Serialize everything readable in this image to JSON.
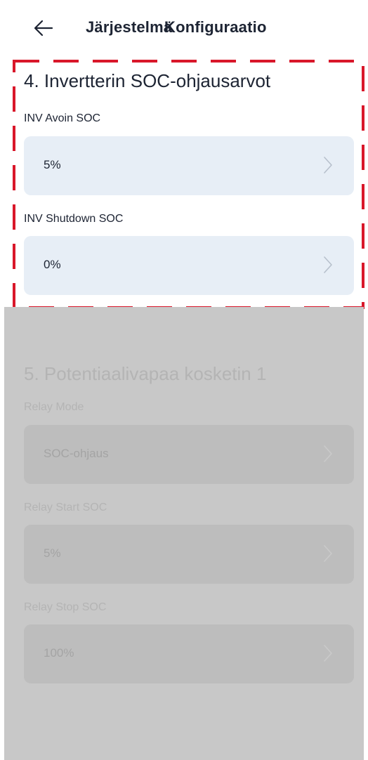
{
  "header": {
    "back_icon": "arrow-left-icon",
    "title_overlap_a": "Järjestelmä",
    "title_overlap_b": "Konfiguraatio"
  },
  "section4": {
    "title": "4. Invertterin SOC-ohjausarvot",
    "fields": [
      {
        "label": "INV  Avoin SOC",
        "value": "5%"
      },
      {
        "label": "INV  Shutdown SOC",
        "value": "0%"
      }
    ]
  },
  "section5": {
    "title": "5. Potentiaalivapaa kosketin 1",
    "fields": [
      {
        "label": "Relay Mode",
        "value": "SOC-ohjaus"
      },
      {
        "label": "Relay Start SOC",
        "value": "5%"
      },
      {
        "label": "Relay Stop SOC",
        "value": "100%"
      }
    ]
  },
  "colors": {
    "highlight_dash": "#d9172a",
    "field_bg": "#e7eef6",
    "overlay": "#c8c8c8",
    "text": "#1d2433"
  }
}
